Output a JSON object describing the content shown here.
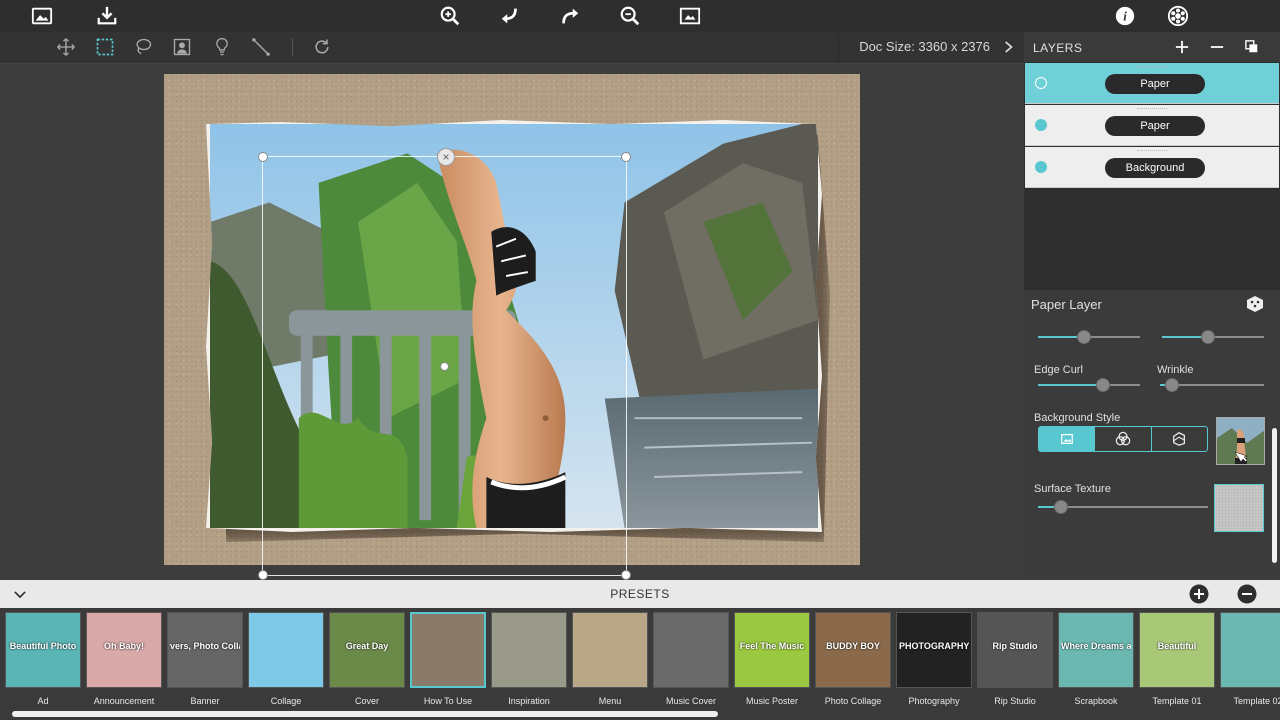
{
  "toolbar": {
    "buttons": [
      "open-image",
      "save",
      "zoom-in",
      "undo",
      "redo",
      "zoom-out",
      "fit-to-screen",
      "info",
      "settings"
    ]
  },
  "tools": {
    "items": [
      "move",
      "rect-select",
      "lasso",
      "person-select",
      "bulb",
      "line",
      "refresh"
    ],
    "doc_size": "Doc Size: 3360 x 2376"
  },
  "layers": {
    "title": "LAYERS",
    "items": [
      {
        "name": "Paper",
        "active": true
      },
      {
        "name": "Paper",
        "active": false
      },
      {
        "name": "Background",
        "active": false
      }
    ]
  },
  "paper_layer": {
    "title": "Paper Layer",
    "sliders": {
      "edge_curl": {
        "label": "Edge Curl",
        "value": 0.66
      },
      "wrinkle": {
        "label": "Wrinkle",
        "value": 0.05
      },
      "top_left": {
        "value": 0.44
      },
      "top_right": {
        "value": 0.44
      },
      "surface_texture": {
        "label": "Surface Texture",
        "value": 0.1
      }
    },
    "background_style_label": "Background Style",
    "background_style_options": [
      "image",
      "color-mix",
      "texture"
    ],
    "background_style_selected": "image"
  },
  "presets": {
    "title": "PRESETS",
    "items": [
      {
        "label": "Ad",
        "color": "#5ab5b5",
        "thumb_text": "Beautiful Photo"
      },
      {
        "label": "Announcement",
        "color": "#d9a8a8",
        "thumb_text": "Oh Baby!"
      },
      {
        "label": "Banner",
        "color": "#666666",
        "thumb_text": "vers, Photo Collage"
      },
      {
        "label": "Collage",
        "color": "#7ec8e8",
        "thumb_text": ""
      },
      {
        "label": "Cover",
        "color": "#6b8a4a",
        "thumb_text": "Great Day"
      },
      {
        "label": "How To Use",
        "color": "#8a7a6a",
        "thumb_text": ""
      },
      {
        "label": "Inspiration",
        "color": "#9a9a8a",
        "thumb_text": ""
      },
      {
        "label": "Menu",
        "color": "#b8a888",
        "thumb_text": ""
      },
      {
        "label": "Music Cover",
        "color": "#6a6a6a",
        "thumb_text": ""
      },
      {
        "label": "Music Poster",
        "color": "#9ac840",
        "thumb_text": "Feel The Music"
      },
      {
        "label": "Photo Collage",
        "color": "#8a6a4a",
        "thumb_text": "BUDDY BOY"
      },
      {
        "label": "Photography",
        "color": "#222222",
        "thumb_text": "PHOTOGRAPHY"
      },
      {
        "label": "Rip Studio",
        "color": "#555555",
        "thumb_text": "Rip Studio"
      },
      {
        "label": "Scrapbook",
        "color": "#6ab8b0",
        "thumb_text": "Where Dreams are Made"
      },
      {
        "label": "Template 01",
        "color": "#a8c878",
        "thumb_text": "Beautiful"
      },
      {
        "label": "Template 02",
        "color": "#6ab8b0",
        "thumb_text": ""
      }
    ]
  },
  "colors": {
    "accent": "#58c7cf",
    "panel": "#2d2d2d",
    "toolbar": "#2e2e2e"
  }
}
